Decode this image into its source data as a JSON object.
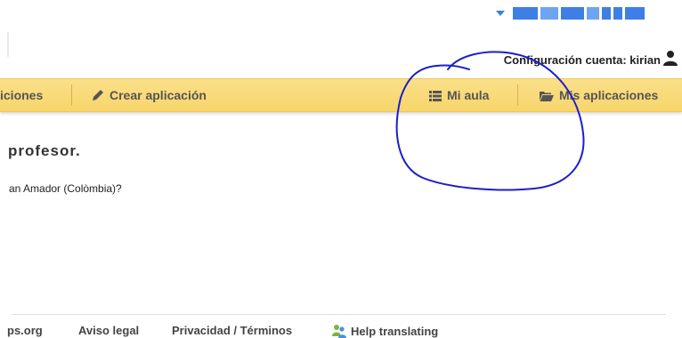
{
  "account": {
    "label": "Configuración cuenta: kirian"
  },
  "nav": {
    "applications": "iciones",
    "create": "Crear aplicación",
    "classroom": "Mi aula",
    "my_apps": "Mis aplicaciones"
  },
  "content": {
    "heading": "profesor.",
    "question": "an Amador (Colòmbia)?"
  },
  "footer": {
    "site": "ps.org",
    "legal": "Aviso legal",
    "privacy": "Privacidad / Términos",
    "translate": "Help translating"
  },
  "colors": {
    "navbar": "#f7d56b",
    "annotation": "#1a1fc9"
  }
}
